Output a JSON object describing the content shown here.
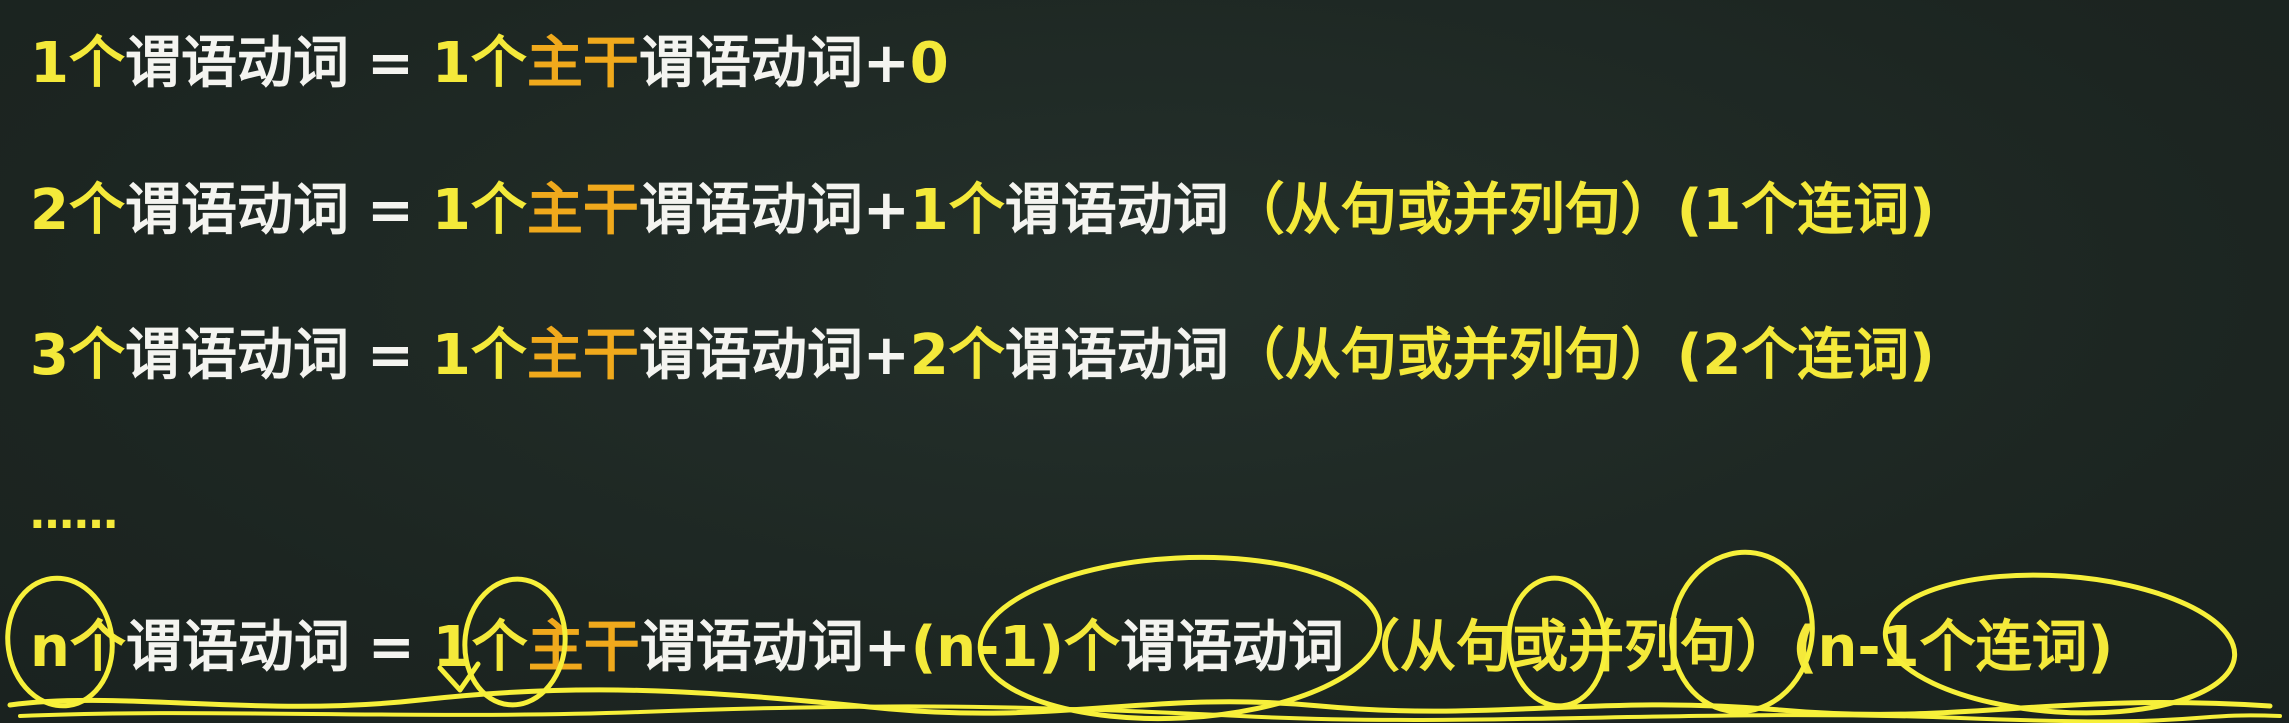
{
  "colors": {
    "background": "#1f2a25",
    "yellow": "#f4e93a",
    "white": "#f4f4f0",
    "orange": "#f0a91c",
    "annotation": "#f7f03a"
  },
  "rows": [
    {
      "id": "row1",
      "lead_num": "1",
      "lead_unit": "个",
      "lead_text": "谓语动词",
      "equals": "=",
      "rhs_num": "1个",
      "rhs_core": "主干",
      "rhs_text": "谓语动词",
      "plus": "+",
      "tail": "0"
    },
    {
      "id": "row2",
      "lead_num": "2",
      "lead_unit": "个",
      "lead_text": "谓语动词",
      "equals": "=",
      "rhs_num": "1个",
      "rhs_core": "主干",
      "rhs_text": "谓语动词",
      "plus": "+",
      "tail_num": "1个",
      "tail_text": "谓语动词",
      "note1": "（从句或并列句）",
      "note2": "(1个连词)"
    },
    {
      "id": "row3",
      "lead_num": "3",
      "lead_unit": "个",
      "lead_text": "谓语动词",
      "equals": "=",
      "rhs_num": "1个",
      "rhs_core": "主干",
      "rhs_text": "谓语动词",
      "plus": "+",
      "tail_num": "2个",
      "tail_text": "谓语动词",
      "note1": "（从句或并列句）",
      "note2": "(2个连词)"
    },
    {
      "id": "row5",
      "lead_num": "n",
      "lead_unit": "个",
      "lead_text": "谓语动词",
      "equals": "=",
      "rhs_num": "1个",
      "rhs_core": "主干",
      "rhs_text": "谓语动词",
      "plus": "+",
      "tail_num": "(n-1)个",
      "tail_text": "谓语动词",
      "note1": "（从句或并列句）",
      "note2": "(n-1个连词)"
    }
  ],
  "ellipsis": "……"
}
